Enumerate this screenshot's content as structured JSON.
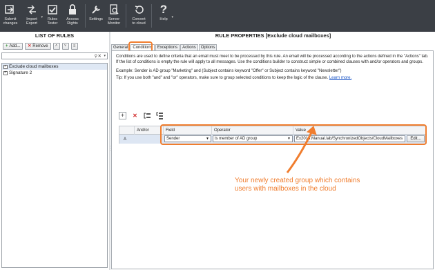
{
  "toolbar": {
    "buttons": [
      {
        "label": "Submit\nchanges",
        "icon": "submit-icon",
        "dropdown": false
      },
      {
        "label": "Import\nExport",
        "icon": "import-export-icon",
        "dropdown": true
      },
      {
        "label": "Rules\nTester",
        "icon": "rules-tester-icon",
        "dropdown": false
      },
      {
        "label": "Access\nRights",
        "icon": "lock-icon",
        "dropdown": false
      },
      {
        "label": "Settings",
        "icon": "wrench-icon",
        "dropdown": false
      },
      {
        "label": "Server\nMonitor",
        "icon": "server-monitor-icon",
        "dropdown": false
      },
      {
        "label": "Convert\nto cloud",
        "icon": "convert-cloud-icon",
        "dropdown": false
      },
      {
        "label": "Help",
        "icon": "help-icon",
        "dropdown": true
      }
    ]
  },
  "left": {
    "title": "LIST OF RULES",
    "add_label": "Add...",
    "remove_label": "Remove",
    "rules": [
      {
        "label": "Exclude cloud mailboxes",
        "checked": true
      },
      {
        "label": "Signature 2",
        "checked": true
      }
    ]
  },
  "right": {
    "title": "RULE PROPERTIES [Exclude cloud mailboxes]",
    "tabs": [
      "General",
      "Conditions",
      "Exceptions",
      "Actions",
      "Options"
    ],
    "description": "Conditions are used to define criteria that an email must meet to be processed by this rule. An email will be processed according to the actions defined in the \"Actions\" tab. If the list of conditions is empty the rule will apply to all messages. Use the conditions builder to construct simple or combined clauses with and/or operators and groups.",
    "example": "Example: Sender is AD group \"Marketing\" and (Subject contains keyword \"Offer\" or Subject contains keyword \"Newsletter\")",
    "tip": "Tip: If you use both \"and\" and \"or\" operators, make sure to group selected conditions to keep the logic of the clause.",
    "learn_more": "Learn more.",
    "grid": {
      "headers": [
        "And/or",
        "Field",
        "Operator",
        "Value"
      ],
      "row": {
        "label": "A",
        "field": "Sender",
        "operator": "is member of AD group",
        "value": "Ex2013.Manual.lab/SynchronizedObjects/CloudMailboxes",
        "edit": "Edit..."
      }
    }
  },
  "annotation": "Your newly created group which contains\nusers with mailboxes in the cloud",
  "colors": {
    "accent": "#f07d2e",
    "toolbar": "#3b3f45",
    "selection": "#dde6f3"
  }
}
